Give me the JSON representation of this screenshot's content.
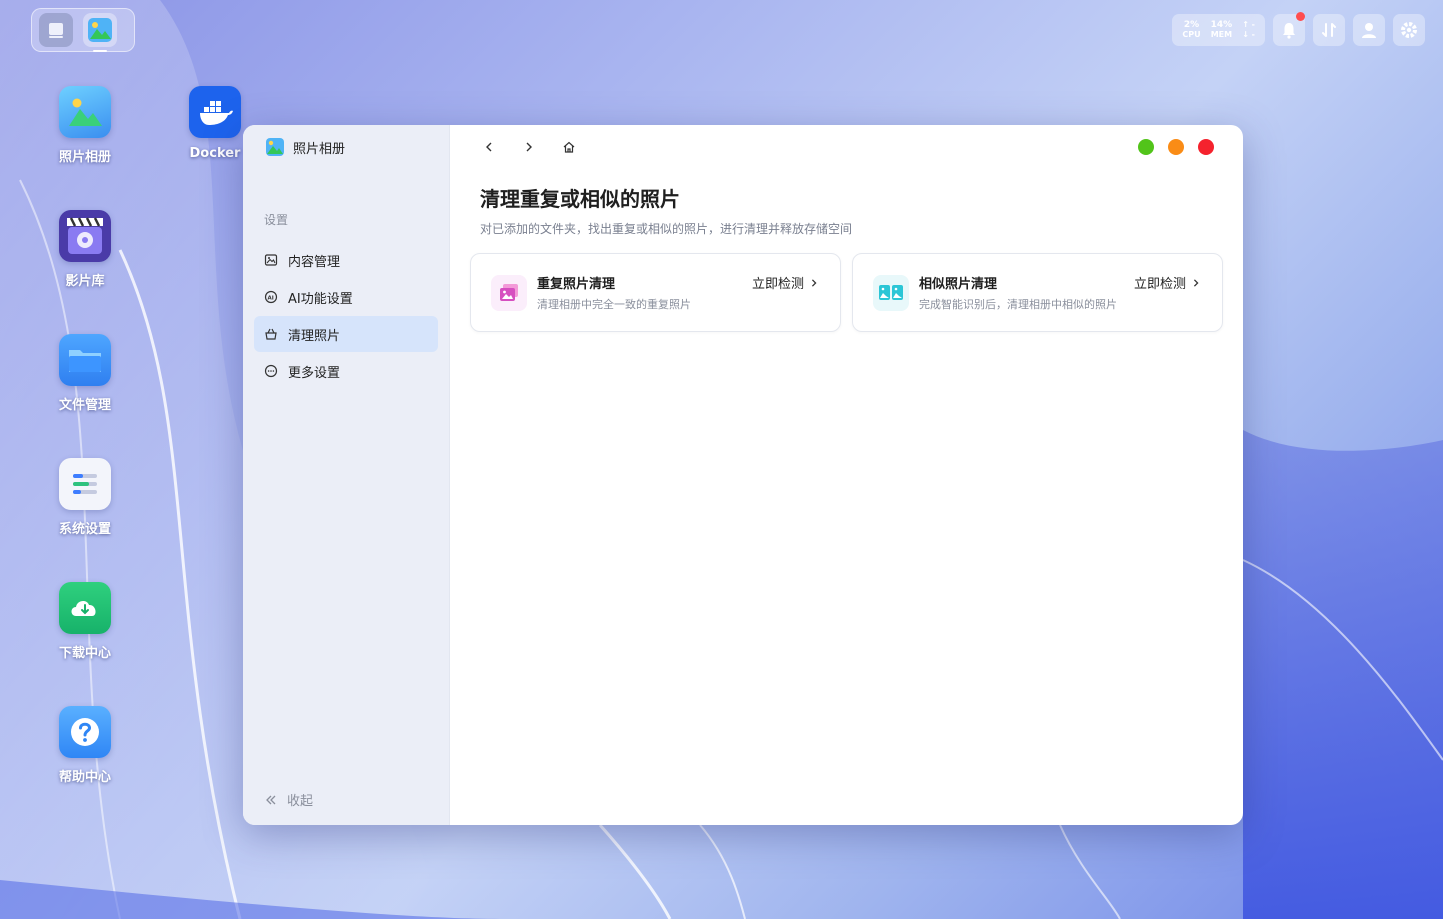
{
  "desktop": {
    "icons": [
      {
        "label": "照片相册"
      },
      {
        "label": "Docker"
      },
      {
        "label": "影片库"
      },
      {
        "label": "文件管理"
      },
      {
        "label": "系统设置"
      },
      {
        "label": "下载中心"
      },
      {
        "label": "帮助中心"
      }
    ]
  },
  "status": {
    "cpu_value": "2%",
    "cpu_label": "CPU",
    "mem_value": "14%",
    "mem_label": "MEM",
    "upload": "↑ -",
    "download": "↓ -"
  },
  "window": {
    "app_name": "照片相册",
    "sidebar": {
      "section": "设置",
      "items": [
        {
          "label": "内容管理",
          "icon": "image-icon"
        },
        {
          "label": "AI功能设置",
          "icon": "ai-icon"
        },
        {
          "label": "清理照片",
          "icon": "basket-icon",
          "active": true
        },
        {
          "label": "更多设置",
          "icon": "more-icon"
        }
      ],
      "collapse_label": "收起"
    },
    "page": {
      "title": "清理重复或相似的照片",
      "subtitle": "对已添加的文件夹，找出重复或相似的照片，进行清理并释放存储空间",
      "cards": [
        {
          "title": "重复照片清理",
          "desc": "清理相册中完全一致的重复照片",
          "action": "立即检测"
        },
        {
          "title": "相似照片清理",
          "desc": "完成智能识别后，清理相册中相似的照片",
          "action": "立即检测"
        }
      ]
    },
    "controls_colors": {
      "minimize": "#52c41a",
      "maximize": "#fa8c16",
      "close": "#f5222d"
    }
  }
}
